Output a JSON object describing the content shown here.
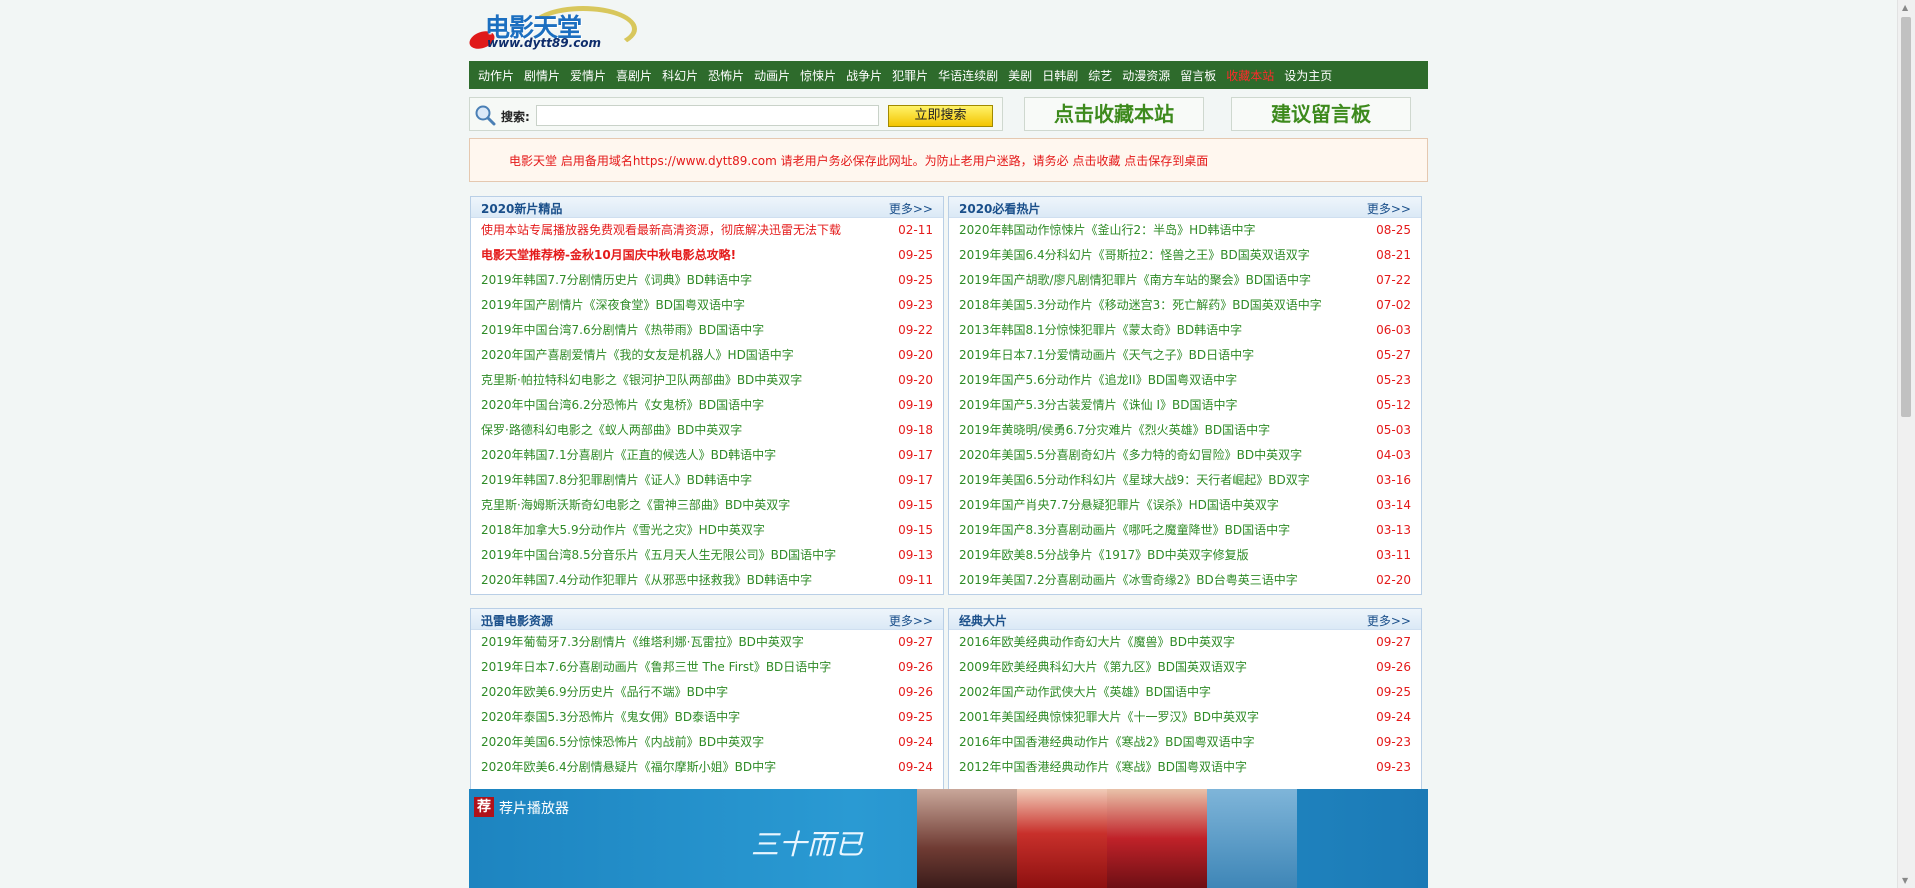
{
  "logo": {
    "title": "电影天堂",
    "url": "www.dytt89.com"
  },
  "nav": {
    "items": [
      {
        "label": "动作片",
        "red": false
      },
      {
        "label": "剧情片",
        "red": false
      },
      {
        "label": "爱情片",
        "red": false
      },
      {
        "label": "喜剧片",
        "red": false
      },
      {
        "label": "科幻片",
        "red": false
      },
      {
        "label": "恐怖片",
        "red": false
      },
      {
        "label": "动画片",
        "red": false
      },
      {
        "label": "惊悚片",
        "red": false
      },
      {
        "label": "战争片",
        "red": false
      },
      {
        "label": "犯罪片",
        "red": false
      },
      {
        "label": "华语连续剧",
        "red": false
      },
      {
        "label": "美剧",
        "red": false
      },
      {
        "label": "日韩剧",
        "red": false
      },
      {
        "label": "综艺",
        "red": false
      },
      {
        "label": "动漫资源",
        "red": false
      },
      {
        "label": "留言板",
        "red": false
      },
      {
        "label": "收藏本站",
        "red": true
      },
      {
        "label": "设为主页",
        "red": false
      }
    ]
  },
  "search": {
    "label": "搜索:",
    "value": "",
    "button": "立即搜索"
  },
  "actions": {
    "bookmark": "点击收藏本站",
    "feedback": "建议留言板"
  },
  "notice": {
    "text": "电影天堂 启用备用域名https://www.dytt89.com 请老用户务必保存此网址。为防止老用户迷路，请务必 点击收藏 点击保存到桌面"
  },
  "colors": {
    "nav_bg": "#2e6b2c",
    "link_green": "#2e8b26",
    "date_red": "#e41a1a",
    "panel_title": "#1a4f8a"
  },
  "panels": [
    {
      "title": "2020新片精品",
      "more": "更多>>",
      "items": [
        {
          "title": "使用本站专属播放器免费观看最新高清资源，彻底解决迅雷无法下载",
          "date": "02-11",
          "style": "red"
        },
        {
          "title": "电影天堂推荐榜-金秋10月国庆中秋电影总攻略!",
          "date": "09-25",
          "style": "red-bold"
        },
        {
          "title": "2019年韩国7.7分剧情历史片《词典》BD韩语中字",
          "date": "09-25"
        },
        {
          "title": "2019年国产剧情片《深夜食堂》BD国粤双语中字",
          "date": "09-23"
        },
        {
          "title": "2019年中国台湾7.6分剧情片《热带雨》BD国语中字",
          "date": "09-22"
        },
        {
          "title": "2020年国产喜剧爱情片《我的女友是机器人》HD国语中字",
          "date": "09-20"
        },
        {
          "title": "克里斯·帕拉特科幻电影之《银河护卫队两部曲》BD中英双字",
          "date": "09-20"
        },
        {
          "title": "2020年中国台湾6.2分恐怖片《女鬼桥》BD国语中字",
          "date": "09-19"
        },
        {
          "title": "保罗·路德科幻电影之《蚁人两部曲》BD中英双字",
          "date": "09-18"
        },
        {
          "title": "2020年韩国7.1分喜剧片《正直的候选人》BD韩语中字",
          "date": "09-17"
        },
        {
          "title": "2019年韩国7.8分犯罪剧情片《证人》BD韩语中字",
          "date": "09-17"
        },
        {
          "title": "克里斯·海姆斯沃斯奇幻电影之《雷神三部曲》BD中英双字",
          "date": "09-15"
        },
        {
          "title": "2018年加拿大5.9分动作片《雪光之灾》HD中英双字",
          "date": "09-15"
        },
        {
          "title": "2019年中国台湾8.5分音乐片《五月天人生无限公司》BD国语中字",
          "date": "09-13"
        },
        {
          "title": "2020年韩国7.4分动作犯罪片《从邪恶中拯救我》BD韩语中字",
          "date": "09-11"
        }
      ]
    },
    {
      "title": "2020必看热片",
      "more": "更多>>",
      "items": [
        {
          "title": "2020年韩国动作惊悚片《釜山行2：半岛》HD韩语中字",
          "date": "08-25"
        },
        {
          "title": "2019年美国6.4分科幻片《哥斯拉2：怪兽之王》BD国英双语双字",
          "date": "08-21"
        },
        {
          "title": "2019年国产胡歌/廖凡剧情犯罪片《南方车站的聚会》BD国语中字",
          "date": "07-22"
        },
        {
          "title": "2018年美国5.3分动作片《移动迷宫3：死亡解药》BD国英双语中字",
          "date": "07-02"
        },
        {
          "title": "2013年韩国8.1分惊悚犯罪片《蒙太奇》BD韩语中字",
          "date": "06-03"
        },
        {
          "title": "2019年日本7.1分爱情动画片《天气之子》BD日语中字",
          "date": "05-27"
        },
        {
          "title": "2019年国产5.6分动作片《追龙II》BD国粤双语中字",
          "date": "05-23"
        },
        {
          "title": "2019年国产5.3分古装爱情片《诛仙 Ⅰ》BD国语中字",
          "date": "05-12"
        },
        {
          "title": "2019年黄晓明/侯勇6.7分灾难片《烈火英雄》BD国语中字",
          "date": "05-03"
        },
        {
          "title": "2020年美国5.5分喜剧奇幻片《多力特的奇幻冒险》BD中英双字",
          "date": "04-03"
        },
        {
          "title": "2019年美国6.5分动作科幻片《星球大战9：天行者崛起》BD双字",
          "date": "03-16"
        },
        {
          "title": "2019年国产肖央7.7分悬疑犯罪片《误杀》HD国语中英双字",
          "date": "03-14"
        },
        {
          "title": "2019年国产8.3分喜剧动画片《哪吒之魔童降世》BD国语中字",
          "date": "03-13"
        },
        {
          "title": "2019年欧美8.5分战争片《1917》BD中英双字修复版",
          "date": "03-11"
        },
        {
          "title": "2019年美国7.2分喜剧动画片《冰雪奇缘2》BD台粤英三语中字",
          "date": "02-20"
        }
      ]
    },
    {
      "title": "迅雷电影资源",
      "more": "更多>>",
      "items": [
        {
          "title": "2019年葡萄牙7.3分剧情片《维塔利娜·瓦雷拉》BD中英双字",
          "date": "09-27"
        },
        {
          "title": "2019年日本7.6分喜剧动画片《鲁邦三世 The First》BD日语中字",
          "date": "09-26"
        },
        {
          "title": "2020年欧美6.9分历史片《品行不端》BD中字",
          "date": "09-26"
        },
        {
          "title": "2020年泰国5.3分恐怖片《鬼女佣》BD泰语中字",
          "date": "09-25"
        },
        {
          "title": "2020年美国6.5分惊悚恐怖片《内战前》BD中英双字",
          "date": "09-24"
        },
        {
          "title": "2020年欧美6.4分剧情悬疑片《福尔摩斯小姐》BD中字",
          "date": "09-24"
        }
      ]
    },
    {
      "title": "经典大片",
      "more": "更多>>",
      "items": [
        {
          "title": "2016年欧美经典动作奇幻大片《魔兽》BD中英双字",
          "date": "09-27"
        },
        {
          "title": "2009年欧美经典科幻大片《第九区》BD国英双语双字",
          "date": "09-26"
        },
        {
          "title": "2002年国产动作武侠大片《英雄》BD国语中字",
          "date": "09-25"
        },
        {
          "title": "2001年美国经典惊悚犯罪大片《十一罗汉》BD中英双字",
          "date": "09-24"
        },
        {
          "title": "2016年中国香港经典动作片《寒战2》BD国粤双语中字",
          "date": "09-23"
        },
        {
          "title": "2012年中国香港经典动作片《寒战》BD国粤双语中字",
          "date": "09-23"
        }
      ]
    }
  ],
  "banner": {
    "badge": "荐",
    "label": "荐片播放器",
    "deco": "三十而已"
  }
}
